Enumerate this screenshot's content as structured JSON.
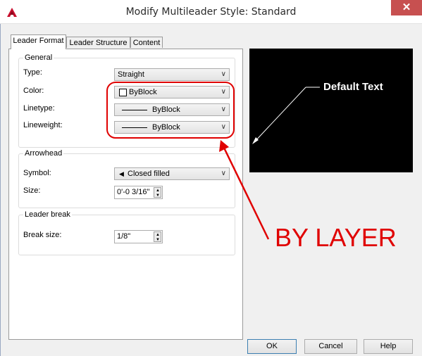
{
  "window": {
    "title": "Modify Multileader Style: Standard",
    "close_glyph": "✕"
  },
  "tabs": [
    {
      "label": "Leader Format",
      "active": true
    },
    {
      "label": "Leader Structure",
      "active": false
    },
    {
      "label": "Content",
      "active": false
    }
  ],
  "general": {
    "legend": "General",
    "type_label": "Type:",
    "type_value": "Straight",
    "color_label": "Color:",
    "color_value": "ByBlock",
    "linetype_label": "Linetype:",
    "linetype_value": "ByBlock",
    "lineweight_label": "Lineweight:",
    "lineweight_value": "ByBlock"
  },
  "arrowhead": {
    "legend": "Arrowhead",
    "symbol_label": "Symbol:",
    "symbol_value": "Closed filled",
    "size_label": "Size:",
    "size_value": "0'-0 3/16\""
  },
  "leader_break": {
    "legend": "Leader break",
    "break_size_label": "Break size:",
    "break_size_value": "1/8\""
  },
  "preview": {
    "text": "Default Text"
  },
  "buttons": {
    "ok": "OK",
    "cancel": "Cancel",
    "help": "Help"
  },
  "annotation": {
    "text": "BY LAYER",
    "color": "#e00000"
  },
  "icons": {
    "app": "autocad-logo-icon",
    "dropdown": "chevron-down-icon",
    "spinner": "spinner-icon"
  },
  "colors": {
    "title_bar": "#ffffff",
    "close_button": "#c75050",
    "annotation": "#e00000"
  }
}
